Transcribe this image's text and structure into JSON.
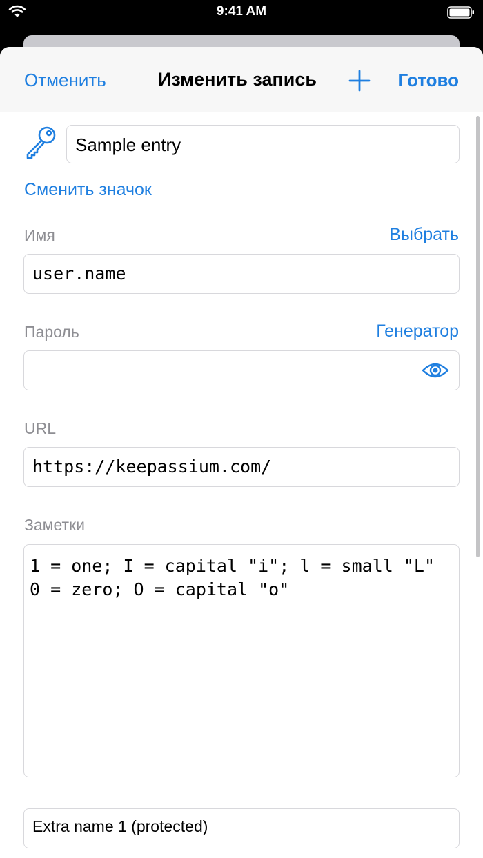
{
  "status_bar": {
    "time": "9:41 AM",
    "wifi_icon": "wifi-icon",
    "battery_icon": "battery-icon"
  },
  "nav": {
    "cancel_label": "Отменить",
    "title": "Изменить запись",
    "add_icon": "plus-icon",
    "done_label": "Готово"
  },
  "colors": {
    "accent": "#1f7fe0",
    "label_gray": "#8e8e93",
    "border": "#d8d8dc"
  },
  "entry": {
    "icon": "key-icon",
    "title_value": "Sample entry",
    "change_icon_label": "Сменить значок"
  },
  "fields": {
    "username": {
      "label": "Имя",
      "action": "Выбрать",
      "value": "user.name"
    },
    "password": {
      "label": "Пароль",
      "action": "Генератор",
      "value": "",
      "reveal_icon": "eye-icon"
    },
    "url": {
      "label": "URL",
      "value": "https://keepassium.com/"
    },
    "notes": {
      "label": "Заметки",
      "value": "1 = one; I = capital \"i\"; l = small \"L\"\n0 = zero; O = capital \"o\""
    },
    "extra": {
      "value": "Extra name 1 (protected)"
    }
  }
}
